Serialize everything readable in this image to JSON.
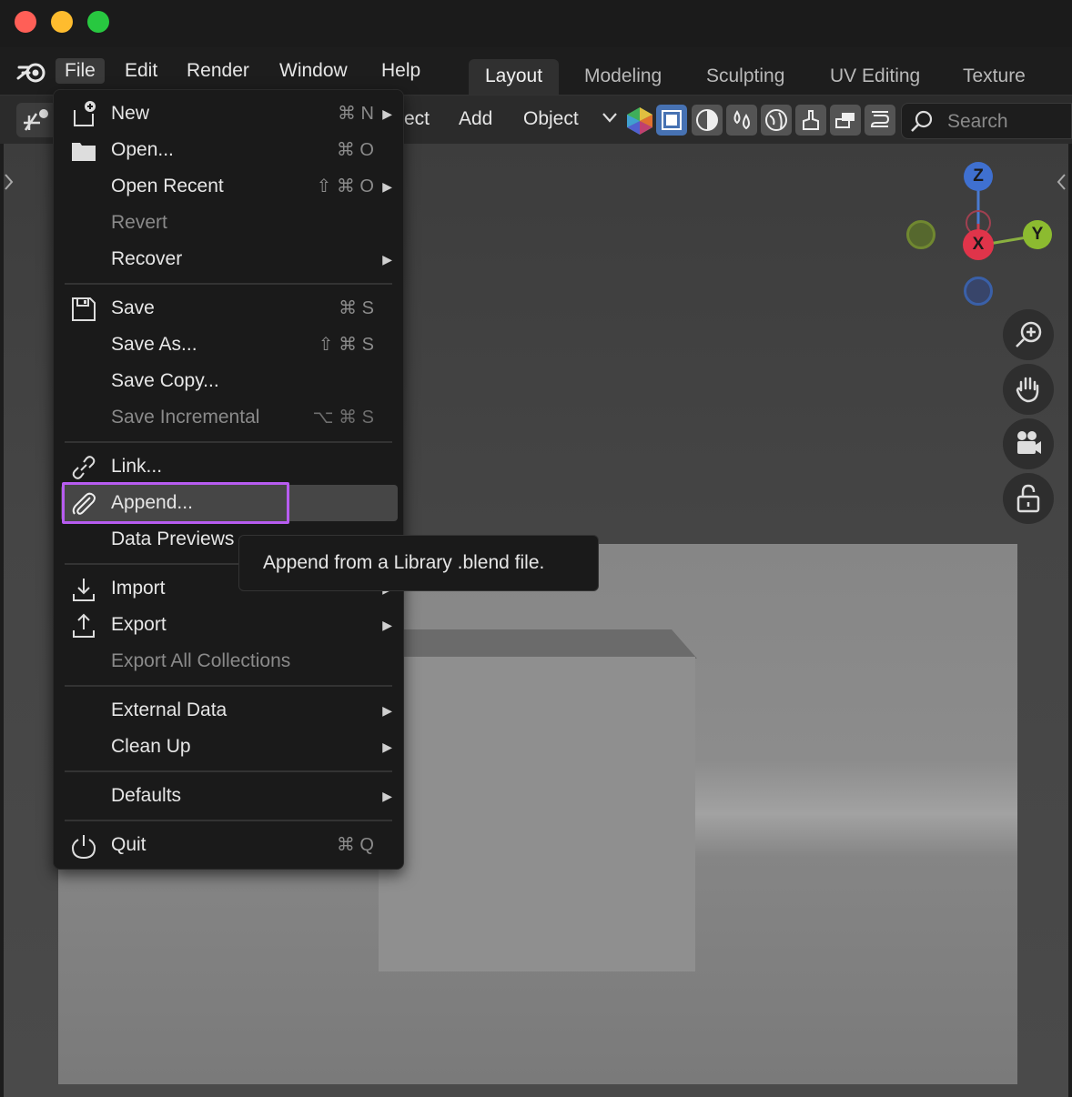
{
  "menubar": {
    "items": [
      "File",
      "Edit",
      "Render",
      "Window",
      "Help"
    ]
  },
  "workspaces": [
    "Layout",
    "Modeling",
    "Sculpting",
    "UV Editing",
    "Texture Pai"
  ],
  "header": {
    "object_partial": "ect",
    "add": "Add",
    "object": "Object",
    "search_placeholder": "Search"
  },
  "gizmo": {
    "z": "Z",
    "y": "Y",
    "x": "X"
  },
  "file_menu": {
    "new": {
      "label": "New",
      "shortcut": "⌘ N"
    },
    "open": {
      "label": "Open...",
      "shortcut": "⌘ O"
    },
    "open_recent": {
      "label": "Open Recent",
      "shortcut": "⇧ ⌘ O"
    },
    "revert": {
      "label": "Revert"
    },
    "recover": {
      "label": "Recover"
    },
    "save": {
      "label": "Save",
      "shortcut": "⌘ S"
    },
    "save_as": {
      "label": "Save As...",
      "shortcut": "⇧ ⌘ S"
    },
    "save_copy": {
      "label": "Save Copy..."
    },
    "save_incremental": {
      "label": "Save Incremental",
      "shortcut": "⌥ ⌘ S"
    },
    "link": {
      "label": "Link..."
    },
    "append": {
      "label": "Append..."
    },
    "data_previews": {
      "label": "Data Previews"
    },
    "import": {
      "label": "Import"
    },
    "export": {
      "label": "Export"
    },
    "export_all": {
      "label": "Export All Collections"
    },
    "external_data": {
      "label": "External Data"
    },
    "clean_up": {
      "label": "Clean Up"
    },
    "defaults": {
      "label": "Defaults"
    },
    "quit": {
      "label": "Quit",
      "shortcut": "⌘ Q"
    }
  },
  "tooltip": "Append from a Library .blend file.",
  "colors": {
    "highlight": "#b75cf0",
    "selected_icon": "#4772b3"
  }
}
